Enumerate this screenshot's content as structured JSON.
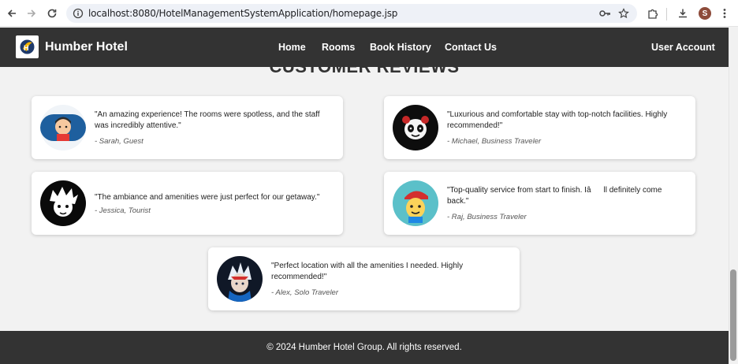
{
  "browser": {
    "url": "localhost:8080/HotelManagementSystemApplication/homepage.jsp",
    "profile_initial": "S"
  },
  "header": {
    "brand": "Humber Hotel",
    "nav": [
      "Home",
      "Rooms",
      "Book History",
      "Contact Us"
    ],
    "account": "User Account"
  },
  "section": {
    "title": "CUSTOMER REVIEWS"
  },
  "reviews": [
    {
      "quote": "\"An amazing experience! The rooms were spotless, and the staff was incredibly attentive.\"",
      "author": "- Sarah, Guest",
      "avatar": "cartoon-boy-avatar-icon"
    },
    {
      "quote": "\"Luxurious and comfortable stay with top-notch facilities. Highly recommended!\"",
      "author": "- Michael, Business Traveler",
      "avatar": "panda-mascot-avatar-icon"
    },
    {
      "quote": "\"The ambiance and amenities were just perfect for our getaway.\"",
      "author": "- Jessica, Tourist",
      "avatar": "anime-character-avatar-icon"
    },
    {
      "quote": "\"Top-quality service from start to finish. Iâll definitely come back.\"",
      "author": "- Raj, Business Traveler",
      "avatar": "cartoon-kid-avatar-icon"
    },
    {
      "quote": "\"Perfect location with all the amenities I needed. Highly recommended!\"",
      "author": "- Alex, Solo Traveler",
      "avatar": "anime-warrior-avatar-icon"
    }
  ],
  "footer": {
    "text": "© 2024 Humber Hotel Group. All rights reserved."
  }
}
